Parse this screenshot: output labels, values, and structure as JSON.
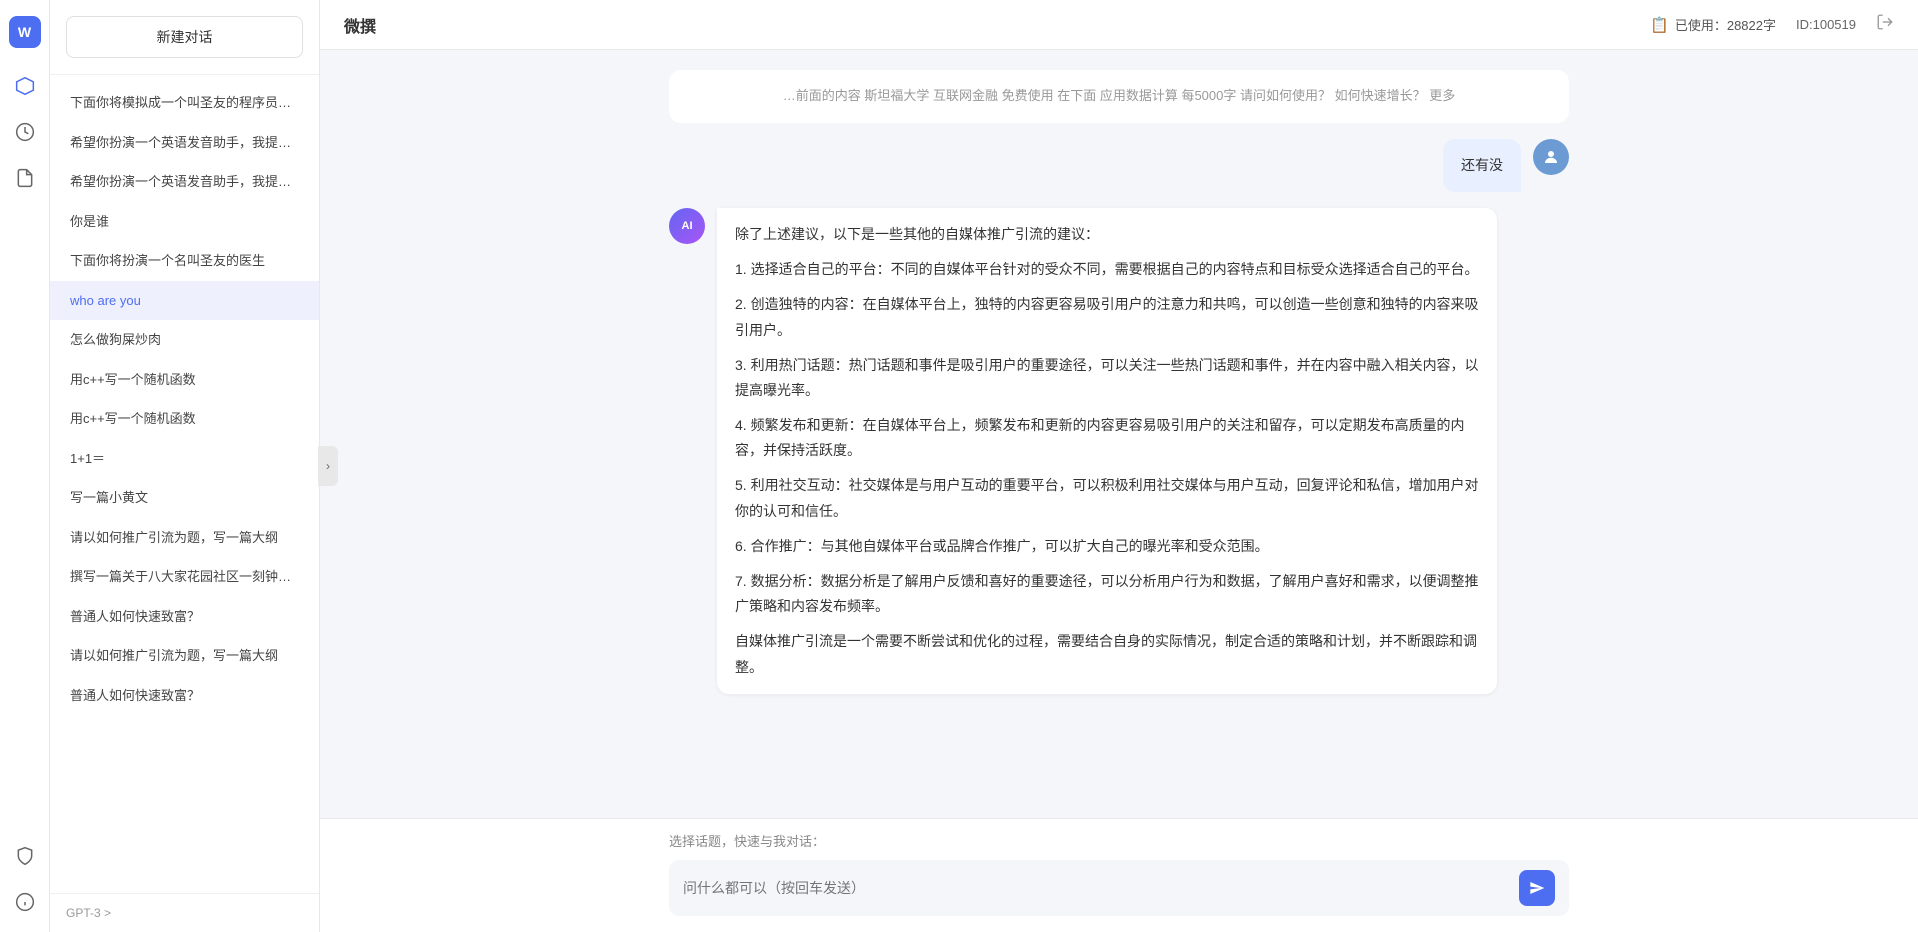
{
  "app": {
    "title": "微撰",
    "logo_text": "W"
  },
  "header": {
    "usage_label": "已使用：28822字",
    "id_label": "ID:100519",
    "usage_icon": "📋"
  },
  "sidebar": {
    "new_chat_label": "新建对话",
    "items": [
      {
        "id": "item-1",
        "label": "下面你将模拟成一个叫圣友的程序员，我说..."
      },
      {
        "id": "item-2",
        "label": "希望你扮演一个英语发音助手，我提供给你..."
      },
      {
        "id": "item-3",
        "label": "希望你扮演一个英语发音助手，我提供给你..."
      },
      {
        "id": "item-4",
        "label": "你是谁"
      },
      {
        "id": "item-5",
        "label": "下面你将扮演一个名叫圣友的医生"
      },
      {
        "id": "item-6",
        "label": "who are you",
        "active": true
      },
      {
        "id": "item-7",
        "label": "怎么做狗屎炒肉"
      },
      {
        "id": "item-8",
        "label": "用c++写一个随机函数"
      },
      {
        "id": "item-9",
        "label": "用c++写一个随机函数"
      },
      {
        "id": "item-10",
        "label": "1+1＝"
      },
      {
        "id": "item-11",
        "label": "写一篇小黄文"
      },
      {
        "id": "item-12",
        "label": "请以如何推广引流为题，写一篇大纲"
      },
      {
        "id": "item-13",
        "label": "撰写一篇关于八大家花园社区一刻钟便民生..."
      },
      {
        "id": "item-14",
        "label": "普通人如何快速致富？"
      },
      {
        "id": "item-15",
        "label": "请以如何推广引流为题，写一篇大纲"
      },
      {
        "id": "item-16",
        "label": "普通人如何快速致富？"
      }
    ],
    "footer_text": "GPT-3 >"
  },
  "chat": {
    "prev_message_text": "…前面的内容  斯坦福大学  互联网金融  免费使用  在下面  应用数据计算  每5000字  请问如何使用？  如何快速增长？  更多",
    "user_message": "还有没",
    "ai_response": {
      "paragraphs": [
        "除了上述建议，以下是一些其他的自媒体推广引流的建议：",
        "1. 选择适合自己的平台：不同的自媒体平台针对的受众不同，需要根据自己的内容特点和目标受众选择适合自己的平台。",
        "2. 创造独特的内容：在自媒体平台上，独特的内容更容易吸引用户的注意力和共鸣，可以创造一些创意和独特的内容来吸引用户。",
        "3. 利用热门话题：热门话题和事件是吸引用户的重要途径，可以关注一些热门话题和事件，并在内容中融入相关内容，以提高曝光率。",
        "4. 频繁发布和更新：在自媒体平台上，频繁发布和更新的内容更容易吸引用户的关注和留存，可以定期发布高质量的内容，并保持活跃度。",
        "5. 利用社交互动：社交媒体是与用户互动的重要平台，可以积极利用社交媒体与用户互动，回复评论和私信，增加用户对你的认可和信任。",
        "6. 合作推广：与其他自媒体平台或品牌合作推广，可以扩大自己的曝光率和受众范围。",
        "7. 数据分析：数据分析是了解用户反馈和喜好的重要途径，可以分析用户行为和数据，了解用户喜好和需求，以便调整推广策略和内容发布频率。",
        "自媒体推广引流是一个需要不断尝试和优化的过程，需要结合自身的实际情况，制定合适的策略和计划，并不断跟踪和调整。"
      ]
    }
  },
  "input": {
    "quick_topics_label": "选择话题，快速与我对话：",
    "placeholder": "问什么都可以（按回车发送）"
  },
  "icons": {
    "toggle": "›",
    "send": "➤",
    "nav_hexagon": "⬡",
    "nav_clock": "🕐",
    "nav_doc": "📄",
    "nav_shield": "🛡",
    "nav_info": "ℹ"
  }
}
